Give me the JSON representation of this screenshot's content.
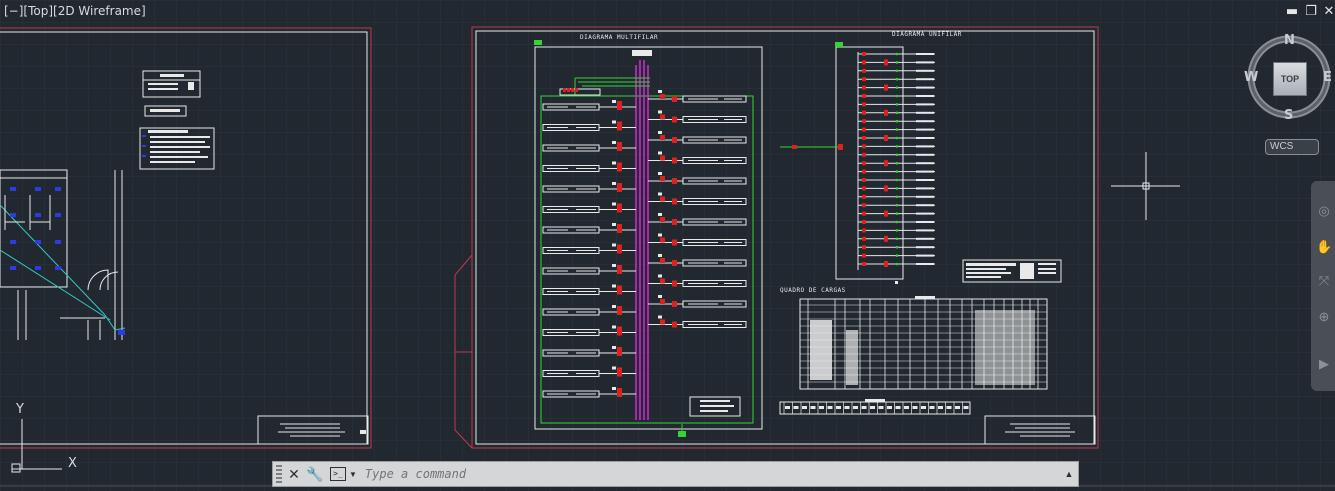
{
  "viewport": {
    "controls_label": "[−]",
    "view_label": "[Top]",
    "style_label": "[2D Wireframe]"
  },
  "window_controls": {
    "minimize": "▬",
    "restore": "❐",
    "close": "✕"
  },
  "drawing": {
    "multifilar_title": "DIAGRAMA MULTIFILAR",
    "unifilar_title": "DIAGRAMA UNIFILAR",
    "loads_title": "QUADRO DE CARGAS"
  },
  "viewcube": {
    "top_face": "TOP",
    "north": "N",
    "south": "S",
    "east": "E",
    "west": "W",
    "wcs_label": "WCS"
  },
  "ucs": {
    "x_label": "X",
    "y_label": "Y"
  },
  "command_line": {
    "placeholder": "Type a command",
    "value": ""
  },
  "colors": {
    "model_background": "#212830",
    "grid": "#2c3440",
    "sheet_border": "#e9e9e9",
    "outer_border": "#c0394b",
    "wire_green": "#35d435",
    "wire_magenta": "#d02bd0",
    "breaker_red": "#e02020",
    "layout_cyan": "#35c8c8",
    "layout_blue": "#2c3ce0"
  }
}
